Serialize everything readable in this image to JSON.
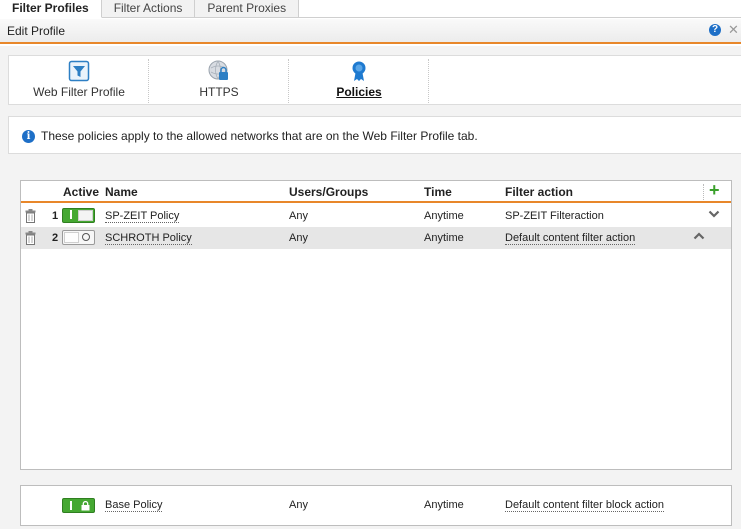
{
  "top_tabs": [
    {
      "label": "Filter Profiles",
      "active": true
    },
    {
      "label": "Filter Actions",
      "active": false
    },
    {
      "label": "Parent Proxies",
      "active": false
    }
  ],
  "header": {
    "title": "Edit Profile",
    "help_icon": "help-icon",
    "close_icon": "close-icon"
  },
  "subtabs": [
    {
      "label": "Web Filter Profile",
      "icon": "filter-icon",
      "active": false
    },
    {
      "label": "HTTPS",
      "icon": "https-globe-lock-icon",
      "active": false
    },
    {
      "label": "Policies",
      "icon": "ribbon-badge-icon",
      "active": true
    }
  ],
  "info": {
    "text": "These policies apply to the allowed networks that are on the Web Filter Profile tab."
  },
  "table": {
    "headers": {
      "active": "Active",
      "name": "Name",
      "users": "Users/Groups",
      "time": "Time",
      "action": "Filter action"
    },
    "rows": [
      {
        "num": "1",
        "active": true,
        "name": "SP-ZEIT Policy",
        "users": "Any",
        "time": "Anytime",
        "action": "SP-ZEIT Filteraction",
        "move_icon": "chevron-down-icon"
      },
      {
        "num": "2",
        "active": false,
        "name": "SCHROTH Policy",
        "users": "Any",
        "time": "Anytime",
        "action": "Default content filter action",
        "move_icon": "chevron-up-icon"
      }
    ]
  },
  "base_policy": {
    "name": "Base Policy",
    "users": "Any",
    "time": "Anytime",
    "action": "Default content filter block action",
    "active": true
  },
  "colors": {
    "accent": "#e8872a",
    "toggle_on": "#45a832",
    "info": "#1e6fc7",
    "add": "#3aa02b"
  }
}
